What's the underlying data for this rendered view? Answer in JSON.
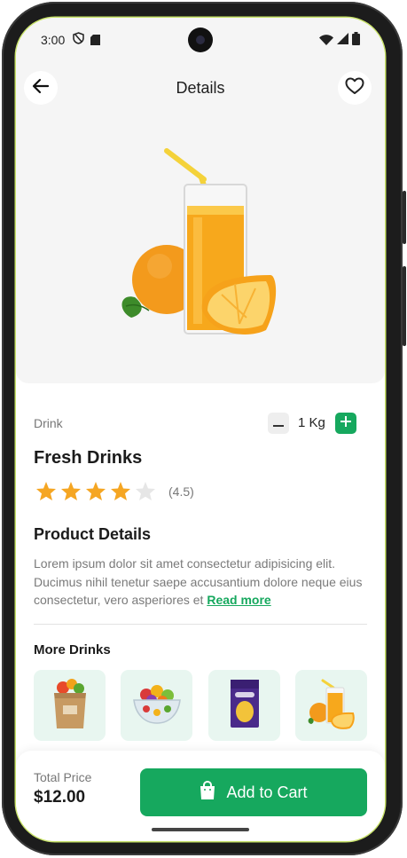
{
  "status_bar": {
    "time": "3:00"
  },
  "header": {
    "title": "Details"
  },
  "product": {
    "category": "Drink",
    "quantity": "1 Kg",
    "name": "Fresh Drinks",
    "rating_stars": 4,
    "rating_max": 5,
    "rating_text": "(4.5)"
  },
  "details": {
    "title": "Product Details",
    "description": "Lorem ipsum dolor sit amet consectetur adipisicing elit. Ducimus nihil tenetur saepe accusantium dolore neque eius consectetur, vero asperiores et",
    "read_more": "Read more"
  },
  "more": {
    "title": "More Drinks",
    "items": [
      {
        "icon": "grocery-bag-icon"
      },
      {
        "icon": "fruit-salad-icon"
      },
      {
        "icon": "chocolate-box-icon"
      },
      {
        "icon": "orange-juice-icon"
      }
    ]
  },
  "footer": {
    "total_label": "Total Price",
    "total_value": "$12.00",
    "cart_label": "Add to Cart"
  },
  "colors": {
    "accent": "#16a85e",
    "star": "#f5a623",
    "star_empty": "#e6e6e6",
    "hero_bg": "#f5f5f5",
    "thumb_bg": "#e8f6f0"
  }
}
